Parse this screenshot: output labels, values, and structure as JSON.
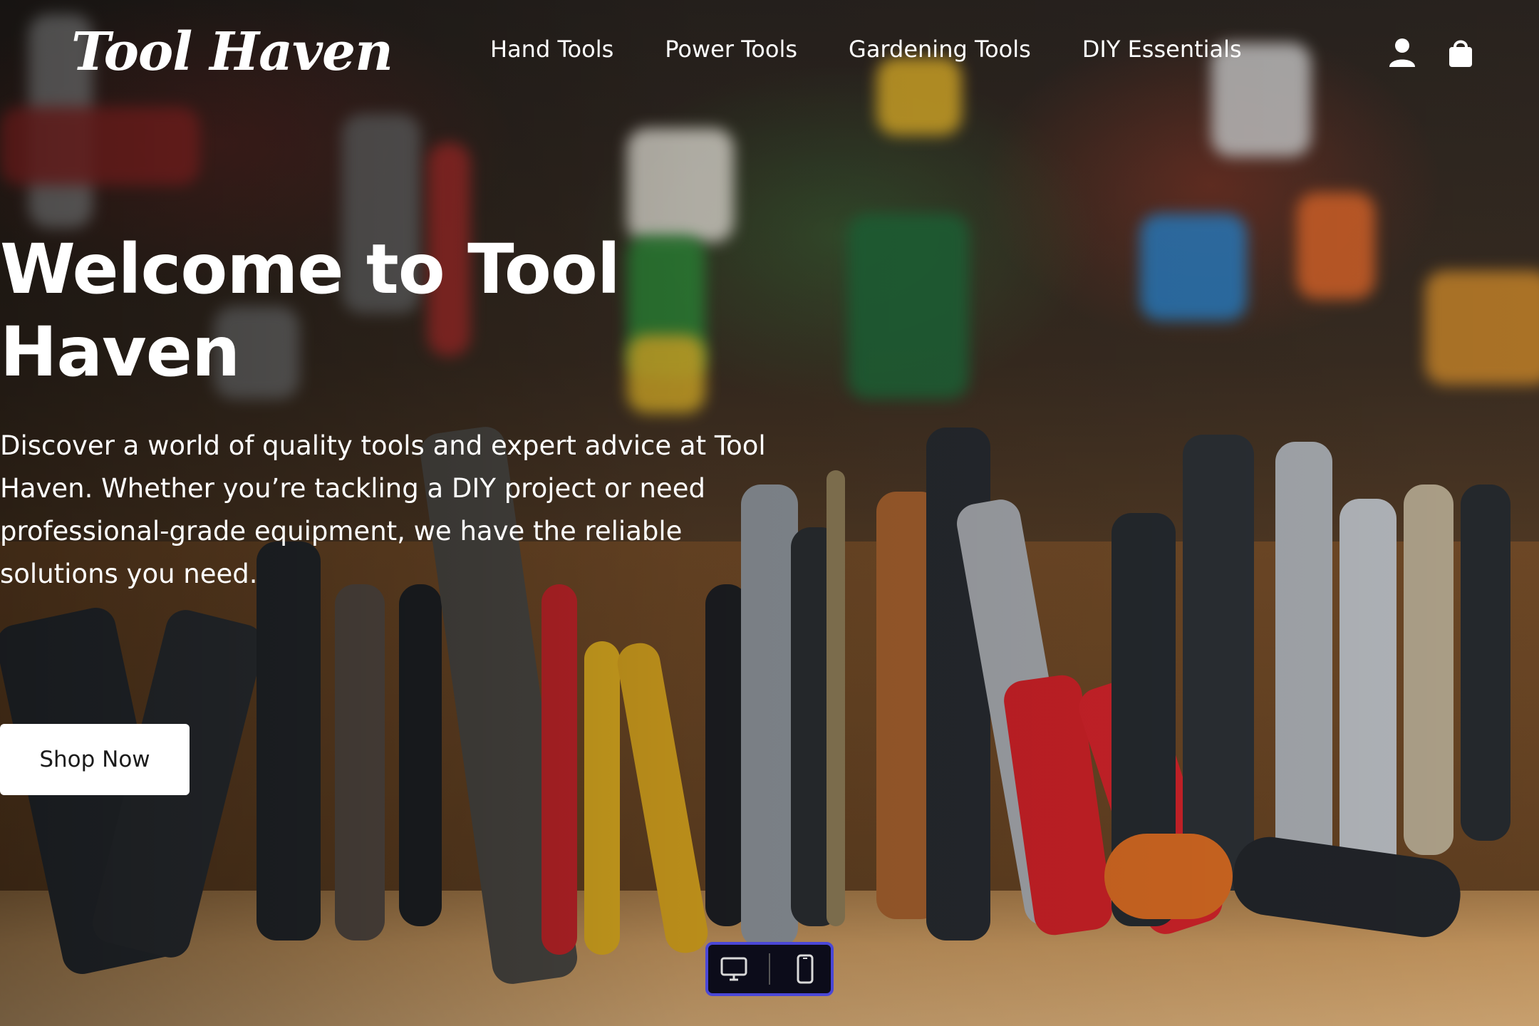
{
  "brand": {
    "logo": "Tool Haven"
  },
  "nav": {
    "items": [
      {
        "label": "Hand Tools"
      },
      {
        "label": "Power Tools"
      },
      {
        "label": "Gardening Tools"
      },
      {
        "label": "DIY Essentials"
      }
    ]
  },
  "header_icons": {
    "account": "user-icon",
    "cart": "shopping-bag-icon"
  },
  "hero": {
    "title": "Welcome to Tool Haven",
    "description": "Discover a world of quality tools and expert advice at Tool Haven. Whether you’re tackling a DIY project or need professional-grade equipment, we have the reliable solutions you need.",
    "cta_label": "Shop Now"
  },
  "device_toggle": {
    "desktop": "monitor-icon",
    "mobile": "phone-icon",
    "accent": "#4a47d6"
  },
  "colors": {
    "text": "#ffffff",
    "button_bg": "#ffffff",
    "button_text": "#1b1b1b"
  }
}
